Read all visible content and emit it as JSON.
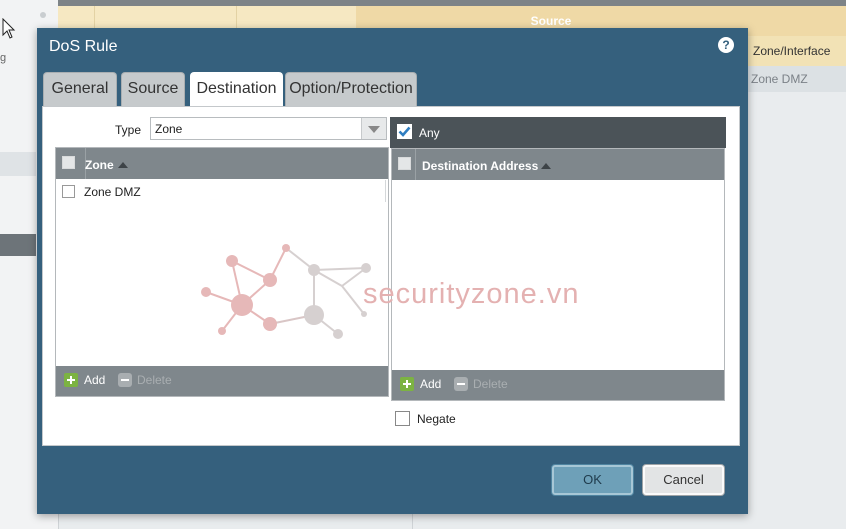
{
  "background": {
    "left_fragment": "g",
    "source_header": "Source",
    "zone_interface_col": "Zone/Interface",
    "zone_dmz_cell": "Zone DMZ"
  },
  "dialog": {
    "title": "DoS Rule",
    "help_icon_label": "?",
    "tabs": [
      {
        "label": "General"
      },
      {
        "label": "Source"
      },
      {
        "label": "Destination"
      },
      {
        "label": "Option/Protection"
      }
    ],
    "active_tab": "Destination",
    "type": {
      "label": "Type",
      "value": "Zone"
    },
    "zone_table": {
      "header": "Zone",
      "rows": [
        {
          "label": "Zone DMZ",
          "checked": false
        }
      ],
      "add_label": "Add",
      "delete_label": "Delete"
    },
    "any": {
      "label": "Any",
      "checked": true
    },
    "address_table": {
      "header": "Destination Address",
      "rows": [],
      "add_label": "Add",
      "delete_label": "Delete"
    },
    "negate": {
      "label": "Negate",
      "checked": false
    },
    "ok_label": "OK",
    "cancel_label": "Cancel"
  },
  "watermark": {
    "text": "securityzone.vn"
  },
  "colors": {
    "dialog_bg": "#35607d",
    "grid_header": "#7f878c",
    "any_bar": "#4b5358",
    "accent_add": "#7cb342",
    "source_header_bg": "#efd9a6"
  },
  "icons": [
    "cursor-icon",
    "help-icon",
    "dropdown-arrow-icon",
    "sort-ascending-icon",
    "add-icon",
    "delete-icon",
    "checkbox-icon"
  ]
}
